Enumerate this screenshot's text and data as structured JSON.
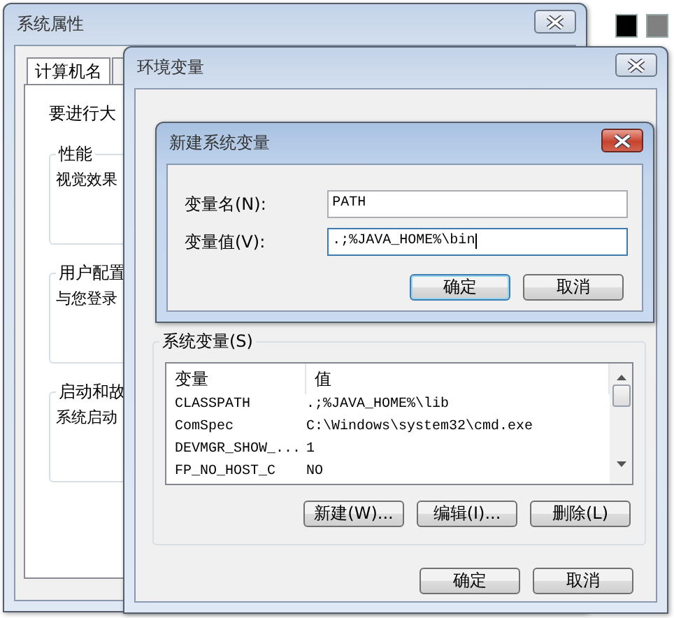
{
  "desktop": {
    "swatches": [
      {
        "color": "#000000"
      },
      {
        "color": "#808080"
      }
    ]
  },
  "system_properties": {
    "title": "系统属性",
    "tabs": [
      {
        "label": "计算机名",
        "selected": true
      }
    ],
    "intro": "要进行大",
    "groups": [
      {
        "label": "性能",
        "text": "视觉效果"
      },
      {
        "label": "用户配置",
        "text": "与您登录"
      },
      {
        "label": "启动和故",
        "text": "系统启动"
      }
    ]
  },
  "environment_variables": {
    "title": "环境变量",
    "system_variables": {
      "label": "系统变量(S)",
      "columns": [
        "变量",
        "值"
      ],
      "rows": [
        {
          "name": "CLASSPATH",
          "value": ".;%JAVA_HOME%\\lib"
        },
        {
          "name": "ComSpec",
          "value": "C:\\Windows\\system32\\cmd.exe"
        },
        {
          "name": "DEVMGR_SHOW_...",
          "value": "1"
        },
        {
          "name": "FP_NO_HOST_C",
          "value": "NO"
        }
      ],
      "buttons": [
        "新建(W)...",
        "编辑(I)...",
        "删除(L)"
      ]
    },
    "buttons": [
      "确定",
      "取消"
    ]
  },
  "new_variable_dialog": {
    "title": "新建系统变量",
    "fields": [
      {
        "label": "变量名(N):",
        "value": "PATH",
        "focused": false
      },
      {
        "label": "变量值(V):",
        "value": ".;%JAVA_HOME%\\bin",
        "focused": true
      }
    ],
    "buttons": [
      {
        "label": "确定",
        "default": true
      },
      {
        "label": "取消",
        "default": false
      }
    ]
  }
}
